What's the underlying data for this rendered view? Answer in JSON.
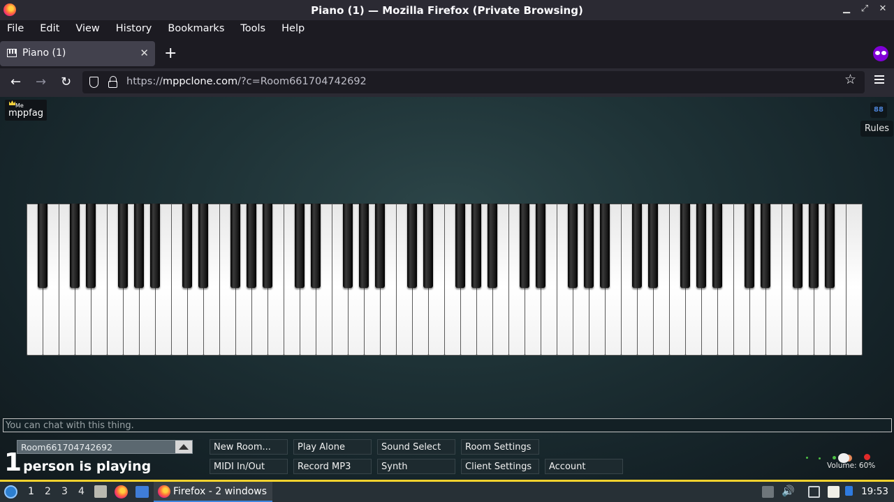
{
  "window": {
    "title": "Piano (1) — Mozilla Firefox (Private Browsing)",
    "minimize": "▁",
    "maximize": "⤢",
    "close": "✕"
  },
  "menu": [
    {
      "label": "File"
    },
    {
      "label": "Edit"
    },
    {
      "label": "View"
    },
    {
      "label": "History"
    },
    {
      "label": "Bookmarks"
    },
    {
      "label": "Tools"
    },
    {
      "label": "Help"
    }
  ],
  "tabs": [
    {
      "label": "Piano (1)",
      "close": "✕"
    }
  ],
  "new_tab": "+",
  "nav": {
    "back": "←",
    "forward": "→",
    "reload": "↻",
    "url_prefix": "https://",
    "url_host": "mppclone.com",
    "url_path": "/?c=Room661704742692",
    "bookmark_star": "☆"
  },
  "page": {
    "me_tag": "Me",
    "me_name": "mppfag",
    "rules_icon": "88",
    "rules_label": "Rules",
    "chat_placeholder": "You can chat with this thing.",
    "room_name": "Room661704742692",
    "player_count": "1",
    "player_text": "person is playing",
    "controls_row1": [
      "New Room...",
      "Play Alone",
      "Sound Select",
      "Room Settings"
    ],
    "controls_row2": [
      "MIDI In/Out",
      "Record MP3",
      "Synth",
      "Client Settings",
      "Account"
    ],
    "volume_label": "Volume: 60%",
    "volume_value": 0.6,
    "piano": {
      "white_keys": 52,
      "black_keys": 36
    }
  },
  "taskbar": {
    "workspaces": [
      "1",
      "2",
      "3",
      "4"
    ],
    "active_workspace": "1",
    "task_label": "Firefox - 2 windows",
    "volume_icon": "🔊",
    "clock": "19:53"
  },
  "colors": {
    "accent_yellow": "#f4d22e",
    "private_purple": "#8000d7",
    "taskbar_bg": "#273036"
  }
}
